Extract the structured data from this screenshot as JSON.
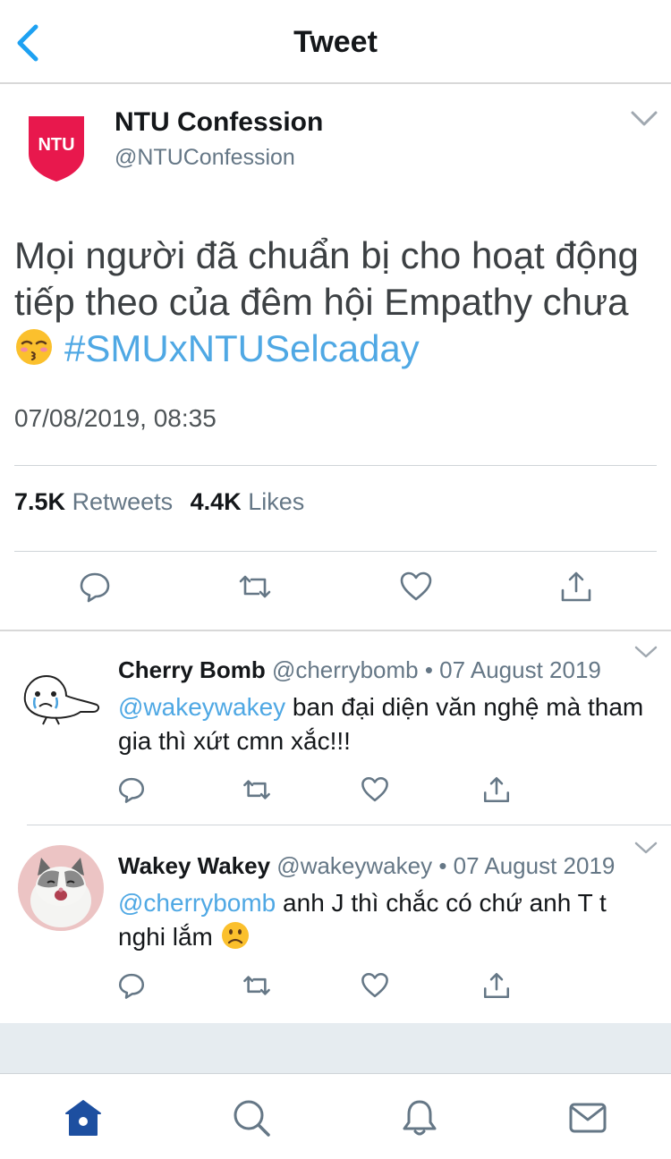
{
  "header": {
    "title": "Tweet"
  },
  "main_tweet": {
    "author_name": "NTU Confession",
    "handle": "@NTUConfession",
    "avatar_label": "NTU",
    "text": "Mọi người đã chuẩn bị cho hoạt động tiếp theo của đêm hội Empathy chưa ",
    "hashtag": "#SMUxNTUSelcaday",
    "timestamp": "07/08/2019, 08:35",
    "retweets_count": "7.5K",
    "retweets_label": "Retweets",
    "likes_count": "4.4K",
    "likes_label": "Likes"
  },
  "replies": [
    {
      "name": "Cherry Bomb",
      "handle": "@cherrybomb",
      "separator": " • ",
      "date": "07 August 2019",
      "mention": "@wakeywakey",
      "text": " ban đại diện văn nghệ mà tham gia thì xứt cmn xắc!!!"
    },
    {
      "name": "Wakey Wakey",
      "handle": "@wakeywakey",
      "separator": " • ",
      "date": "07 August 2019",
      "mention": "@cherrybomb",
      "text": " anh J thì chắc có chứ anh T t nghi lắm "
    }
  ],
  "icons": {
    "back": "chevron-left-icon",
    "caret": "chevron-down-icon",
    "reply": "reply-icon",
    "retweet": "retweet-icon",
    "like": "heart-icon",
    "share": "share-icon",
    "tabs": [
      "home-icon",
      "search-icon",
      "notifications-icon",
      "messages-icon"
    ]
  },
  "colors": {
    "accent": "#1da1f2",
    "link": "#4fa8e4",
    "ntu_brand": "#e8184d",
    "tab_active": "#1d4fa0",
    "icon_gray": "#657786"
  }
}
